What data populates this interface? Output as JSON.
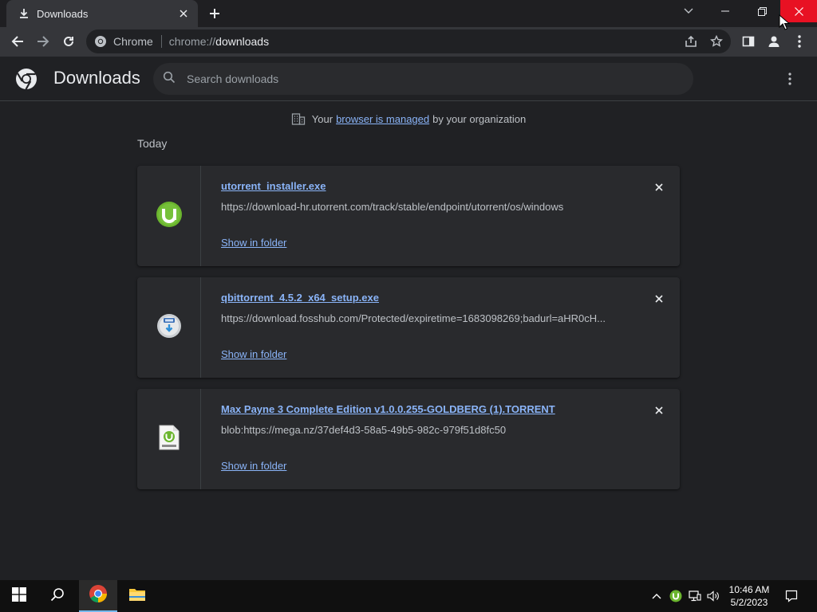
{
  "window": {
    "tab_title": "Downloads",
    "tab_icon": "download-icon",
    "controls": [
      "minimize",
      "restore",
      "close"
    ]
  },
  "toolbar": {
    "chip_label": "Chrome",
    "url_scheme": "chrome://",
    "url_host": "downloads"
  },
  "page": {
    "title": "Downloads",
    "search_placeholder": "Search downloads",
    "managed": {
      "prefix": "Your",
      "link": "browser is managed",
      "suffix": "by your organization"
    },
    "section": "Today",
    "downloads": [
      {
        "name": "utorrent_installer.exe",
        "url": "https://download-hr.utorrent.com/track/stable/endpoint/utorrent/os/windows",
        "action": "Show in folder",
        "icon": "utorrent-icon"
      },
      {
        "name": "qbittorrent_4.5.2_x64_setup.exe",
        "url": "https://download.fosshub.com/Protected/expiretime=1683098269;badurl=aHR0cH...",
        "action": "Show in folder",
        "icon": "installer-icon"
      },
      {
        "name": "Max Payne 3 Complete Edition v1.0.0.255-GOLDBERG (1).TORRENT",
        "url": "blob:https://mega.nz/37def4d3-58a5-49b5-982c-979f51d8fc50",
        "action": "Show in folder",
        "icon": "torrent-file-icon"
      }
    ]
  },
  "taskbar": {
    "time": "10:46 AM",
    "date": "5/2/2023"
  },
  "colors": {
    "accent_link": "#8ab4f8",
    "background": "#202124",
    "card": "#292a2d",
    "close_red": "#e81123",
    "utorrent_green": "#6bb52e"
  }
}
